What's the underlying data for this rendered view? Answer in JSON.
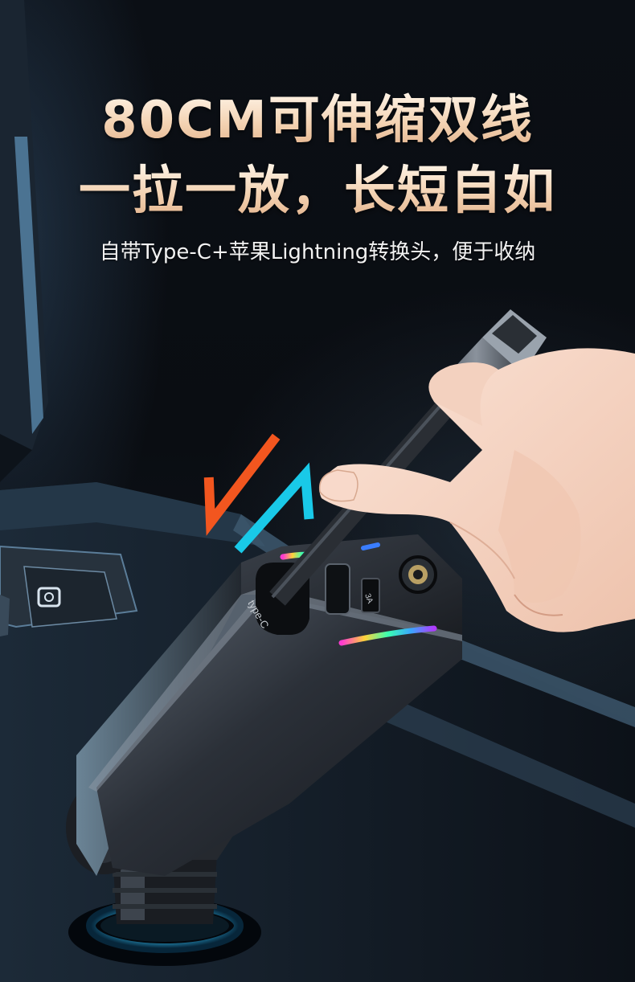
{
  "headline": {
    "line1": "80CM可伸缩双线",
    "line2": "一拉一放，长短自如"
  },
  "subtitle": "自带Type-C+苹果Lightning转换头，便于收纳",
  "product": {
    "port_label": "type-C",
    "usb_label": "3A"
  },
  "colors": {
    "headline_gradient_top": "#fff6ea",
    "headline_gradient_bottom": "#e2b18a",
    "arrow_pull": "#f2561f",
    "arrow_retract": "#19c9e8",
    "base_glow": "#4fd6ff"
  }
}
